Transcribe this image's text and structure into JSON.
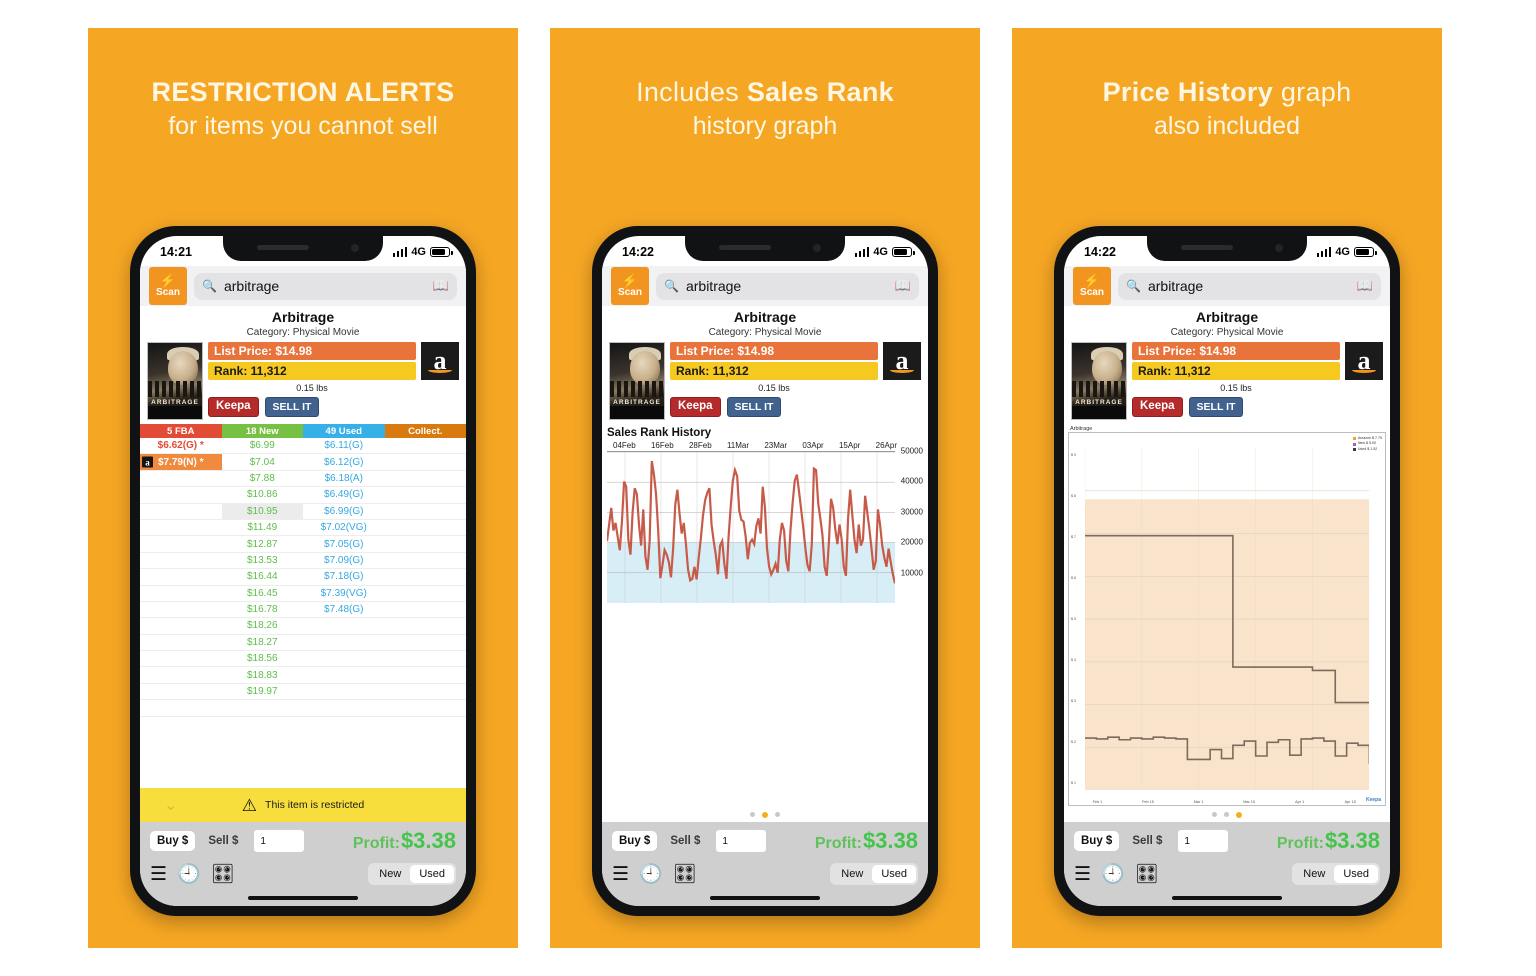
{
  "brand": {
    "accent": "#F5A623",
    "heading_color": "#FFF6E3"
  },
  "panels": [
    {
      "heading_line1_bold": "RESTRICTION ALERTS",
      "heading_line2": "for items you cannot sell",
      "status": {
        "time": "14:21",
        "network": "4G"
      }
    },
    {
      "heading_pre": "Includes ",
      "heading_bold": "Sales Rank",
      "heading_line2": "history graph",
      "status": {
        "time": "14:22",
        "network": "4G"
      }
    },
    {
      "heading_bold": "Price History",
      "heading_post": " graph",
      "heading_line2": "also included",
      "status": {
        "time": "14:22",
        "network": "4G"
      }
    }
  ],
  "app": {
    "scan_label": "Scan",
    "scan_icon": "bolt-icon",
    "search_value": "arbitrage",
    "search_icon": "search-icon",
    "book_icon": "book-icon",
    "product": {
      "title": "Arbitrage",
      "category": "Category: Physical Movie",
      "list_price": "List Price:  $14.98",
      "rank": "Rank: 11,312",
      "weight": "0.15 lbs",
      "keepa_button": "Keepa",
      "sellit_button": "SELL IT",
      "poster_caption": "ARBITRAGE",
      "amazon_icon": "amazon-logo-icon"
    },
    "offers": {
      "headers": [
        "5 FBA",
        "18 New",
        "49 Used",
        "Collect."
      ],
      "rows": [
        {
          "fba": "$6.62(G) *",
          "new": "$6.99",
          "used": "$6.11(G)",
          "collect": ""
        },
        {
          "fba": "$7.79(N) *",
          "fba_amazon": true,
          "new": "$7.04",
          "used": "$6.12(G)",
          "collect": ""
        },
        {
          "fba": "",
          "new": "$7.88",
          "used": "$6.18(A)",
          "collect": ""
        },
        {
          "fba": "",
          "new": "$10.86",
          "used": "$6.49(G)",
          "collect": ""
        },
        {
          "fba": "",
          "new": "$10.95",
          "new_hl": true,
          "used": "$6.99(G)",
          "collect": ""
        },
        {
          "fba": "",
          "new": "$11.49",
          "used": "$7.02(VG)",
          "collect": ""
        },
        {
          "fba": "",
          "new": "$12.87",
          "used": "$7.05(G)",
          "collect": ""
        },
        {
          "fba": "",
          "new": "$13.53",
          "used": "$7.09(G)",
          "collect": ""
        },
        {
          "fba": "",
          "new": "$16.44",
          "used": "$7.18(G)",
          "collect": ""
        },
        {
          "fba": "",
          "new": "$16.45",
          "used": "$7.39(VG)",
          "collect": ""
        },
        {
          "fba": "",
          "new": "$16.78",
          "used": "$7.48(G)",
          "collect": ""
        },
        {
          "fba": "",
          "new": "$18.26",
          "used": "",
          "collect": ""
        },
        {
          "fba": "",
          "new": "$18.27",
          "used": "",
          "collect": ""
        },
        {
          "fba": "",
          "new": "$18.56",
          "used": "",
          "collect": ""
        },
        {
          "fba": "",
          "new": "$18.83",
          "used": "",
          "collect": ""
        },
        {
          "fba": "",
          "new": "$19.97",
          "used": "",
          "collect": ""
        },
        {
          "fba": "",
          "new": "",
          "used": "",
          "collect": ""
        }
      ]
    },
    "restricted_banner": {
      "message": "This item is restricted",
      "warning_icon": "warning-triangle-icon",
      "chevron_icon": "chevron-down-icon"
    },
    "toolbar": {
      "buy_label": "Buy $",
      "sell_label": "Sell $",
      "quantity": "1",
      "profit_label": "Profit:",
      "profit_value": "$3.38",
      "list_icon": "list-icon",
      "history_icon": "history-clock-icon",
      "sliders_icon": "sliders-icon",
      "new_label": "New",
      "used_label": "Used",
      "active_condition": "Used"
    },
    "page_dots": {
      "count": 3,
      "active_phone2": 1,
      "active_phone3": 2
    }
  },
  "chart_data": [
    {
      "type": "line",
      "title": "Sales Rank History",
      "xlabel": "",
      "ylabel": "",
      "ylim": [
        0,
        50000
      ],
      "yticks": [
        50000,
        40000,
        30000,
        20000,
        10000
      ],
      "grid": true,
      "legend": "none",
      "line_color": "#C75B4A",
      "fill_color": "#D8EEF6",
      "tick_labels": [
        "04Feb",
        "16Feb",
        "28Feb",
        "11Mar",
        "23Mar",
        "03Apr",
        "15Apr",
        "26Apr"
      ],
      "values": [
        20500,
        26000,
        31500,
        24000,
        26500,
        22000,
        17500,
        27000,
        40200,
        38500,
        21000,
        16000,
        30000,
        38000,
        36000,
        26000,
        19000,
        31000,
        15500,
        11000,
        20500,
        47000,
        42500,
        36000,
        24000,
        8200,
        12500,
        17500,
        16000,
        13500,
        8500,
        18000,
        32500,
        37500,
        29500,
        23000,
        26500,
        19500,
        11000,
        7500,
        8000,
        12000,
        7800,
        15000,
        21500,
        29000,
        34000,
        36500,
        38000,
        26000,
        20500,
        16000,
        9500,
        19000,
        20500,
        13000,
        8000,
        22000,
        32000,
        40500,
        44000,
        42000,
        30500,
        27500,
        27000,
        22000,
        14500,
        20000,
        21000,
        19500,
        25500,
        28000,
        23000,
        38500,
        32000,
        18000,
        12000,
        9500,
        11000,
        13000,
        10000,
        21000,
        26500,
        24000,
        14000,
        10500,
        24000,
        33000,
        40500,
        42500,
        37000,
        31000,
        25000,
        18000,
        12500,
        10500,
        19500,
        44500,
        44000,
        33000,
        28000,
        22500,
        12000,
        9000,
        20000,
        34500,
        31500,
        24500,
        19500,
        26000,
        21000,
        12000,
        9000,
        28000,
        37500,
        29000,
        21000,
        16500,
        26000,
        19000,
        21000,
        35500,
        30000,
        24500,
        18000,
        11000,
        14000,
        31000,
        26000,
        19000,
        15000,
        12000,
        18000,
        13500,
        9500,
        6500
      ]
    },
    {
      "type": "line",
      "title": "Arbitrage",
      "source": "Keepa",
      "legend_position": "top-right",
      "legend": [
        "Amazon $ 7.79",
        "New $ 5.00",
        "Used $ 1.52"
      ],
      "grid": true,
      "fill_color": "#FAE3CB",
      "line_color": "#7d6a5c",
      "yticks": [
        "$ 9",
        "$ 8",
        "$ 7",
        "$ 6",
        "$ 5",
        "$ 4",
        "$ 3",
        "$ 2",
        "$ 1"
      ],
      "xticks": [
        "Feb 1",
        "Feb 15",
        "Mar 1",
        "Mar 15",
        "Apr 1",
        "Apr 15"
      ],
      "series": [
        {
          "name": "New",
          "values": [
            6.95,
            6.95,
            6.95,
            6.95,
            6.95,
            6.95,
            6.95,
            6.95,
            6.95,
            6.95,
            6.95,
            6.95,
            6.95,
            3.88,
            3.88,
            3.88,
            3.88,
            3.88,
            3.88,
            3.88,
            3.8,
            3.8,
            3.05,
            3.05,
            3.05,
            3.05
          ]
        },
        {
          "name": "Used",
          "values": [
            2.22,
            2.2,
            2.24,
            2.18,
            2.22,
            2.2,
            2.24,
            2.22,
            2.2,
            1.72,
            1.72,
            1.95,
            1.74,
            2.05,
            2.15,
            1.8,
            2.12,
            2.18,
            1.82,
            2.2,
            2.22,
            2.15,
            1.8,
            2.1,
            2.05,
            1.62
          ]
        }
      ]
    }
  ]
}
